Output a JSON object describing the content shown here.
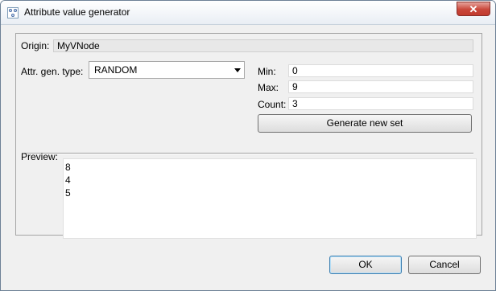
{
  "window": {
    "title": "Attribute value generator",
    "close_label": "✕",
    "app_icon": "graph-icon"
  },
  "form": {
    "origin_label": "Origin:",
    "origin_value": "MyVNode",
    "gen_type_label": "Attr. gen. type:",
    "gen_type_value": "RANDOM",
    "min_label": "Min:",
    "min_value": "0",
    "max_label": "Max:",
    "max_value": "9",
    "count_label": "Count:",
    "count_value": "3",
    "generate_button": "Generate new set"
  },
  "preview": {
    "label": "Preview:",
    "values": [
      "8",
      "4",
      "5"
    ]
  },
  "buttons": {
    "ok": "OK",
    "cancel": "Cancel"
  }
}
